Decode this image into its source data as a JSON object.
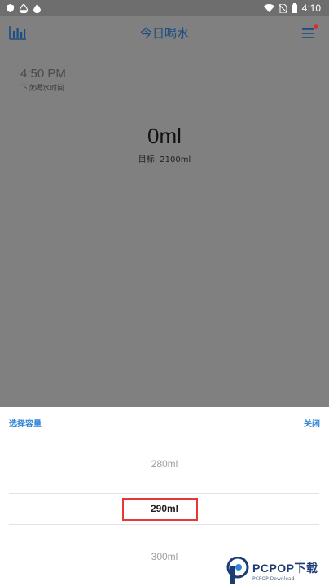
{
  "status_bar": {
    "time": "4:10",
    "left_icons": [
      "shield-icon",
      "water-drop-half-icon",
      "water-drop-icon"
    ],
    "right_icons": [
      "wifi-icon",
      "no-sim-icon",
      "battery-icon"
    ]
  },
  "app_bar": {
    "title": "今日喝水",
    "left_icon": "bar-chart-icon",
    "right_icon": "menu-icon",
    "accent": "#1c4d82",
    "notification_dot_color": "#d32f2f"
  },
  "next_reminder": {
    "time": "4:50 PM",
    "label": "下次喝水时间"
  },
  "intake": {
    "value": "0ml",
    "goal": "目标: 2100ml"
  },
  "capacity_sheet": {
    "title": "选择容量",
    "close_label": "关闭",
    "accent": "#2e86d6",
    "options": [
      "280ml",
      "290ml",
      "300ml"
    ],
    "selected": "290ml",
    "highlight_color": "#e53935"
  },
  "watermark": {
    "text": "PCPOP下载",
    "subtext": "PCPOP Download",
    "color": "#1b3d74"
  }
}
